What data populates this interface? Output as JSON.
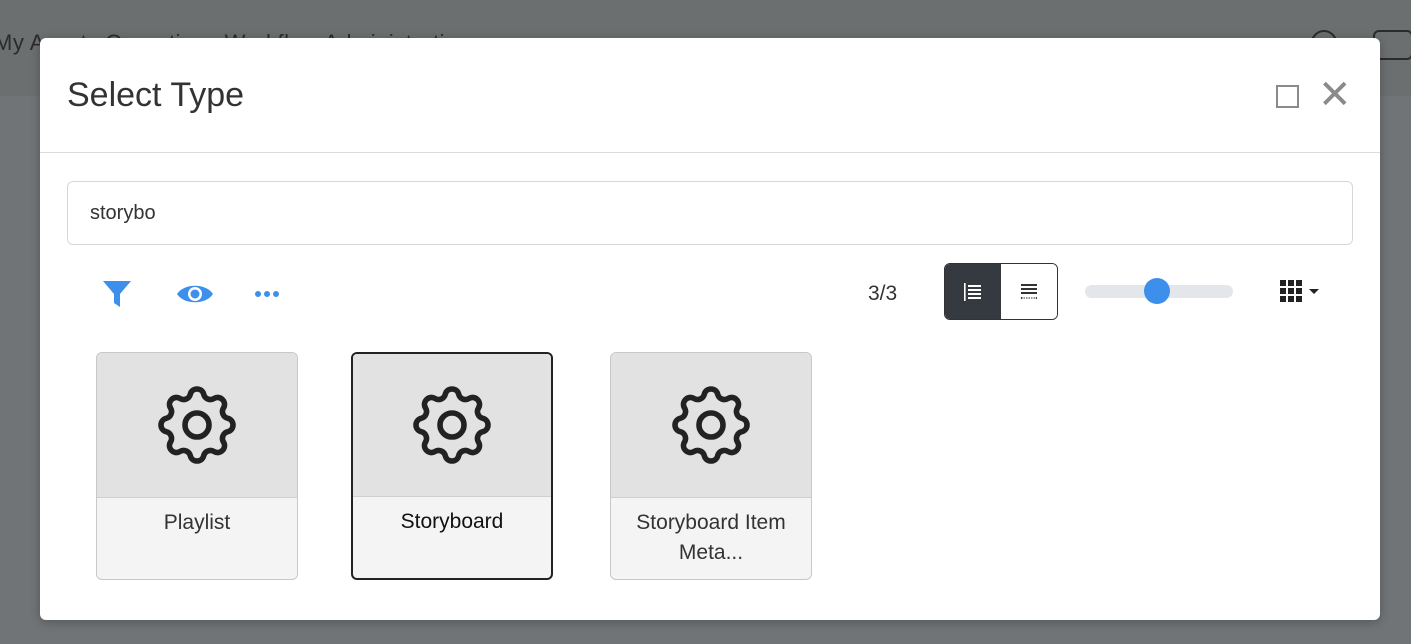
{
  "background": {
    "nav_text": "My Assets    Operations    Workflow    Administration"
  },
  "modal": {
    "title": "Select Type",
    "maximize_icon": "square-icon",
    "close_symbol": "✕"
  },
  "search": {
    "value": "storybo",
    "placeholder": ""
  },
  "toolbar": {
    "icons": [
      "filter-icon",
      "eye-icon",
      "ellipsis-icon"
    ],
    "count": "3/3",
    "view_modes": [
      "list-view-icon",
      "detail-view-icon"
    ],
    "active_view": "list-view-icon",
    "zoom_level": 0.55,
    "layout_icon": "grid-icon"
  },
  "cards": [
    {
      "icon": "gear-icon",
      "label": "Playlist",
      "selected": false
    },
    {
      "icon": "gear-icon",
      "label": "Storyboard",
      "selected": true
    },
    {
      "icon": "gear-icon",
      "label": "Storyboard Item Meta...",
      "selected": false
    }
  ],
  "colors": {
    "accent": "#3d8fec",
    "overlay": "#6b6f70",
    "active_toggle": "#343a40"
  }
}
